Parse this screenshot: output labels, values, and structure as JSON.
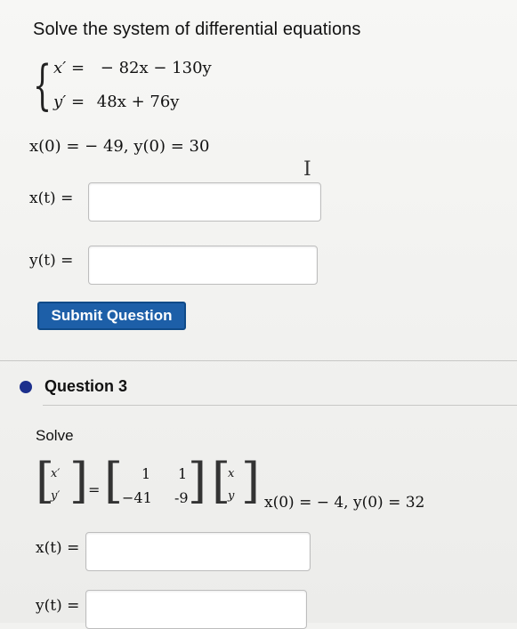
{
  "question1": {
    "prompt": "Solve the system of differential equations",
    "eq1_lhs": "x′ =",
    "eq1_rhs": "− 82x − 130y",
    "eq2_lhs": "y′ =",
    "eq2_rhs": "48x + 76y",
    "initial_conditions": "x(0) = − 49,  y(0) = 30",
    "x_label": "x(t) =",
    "y_label": "y(t) =",
    "x_value": "",
    "y_value": ""
  },
  "submit_label": "Submit Question",
  "question3": {
    "title": "Question 3",
    "instruction": "Solve",
    "vec_lhs_top": "x′",
    "vec_lhs_bottom": "y′",
    "equals": "=",
    "matrix": [
      "1",
      "1",
      "−41",
      "-9"
    ],
    "vec_rhs_top": "x",
    "vec_rhs_bottom": "y",
    "initial_conditions": "x(0) = − 4, y(0) = 32",
    "x_label": "x(t) =",
    "y_label": "y(t) =",
    "x_value": "",
    "y_value": ""
  }
}
